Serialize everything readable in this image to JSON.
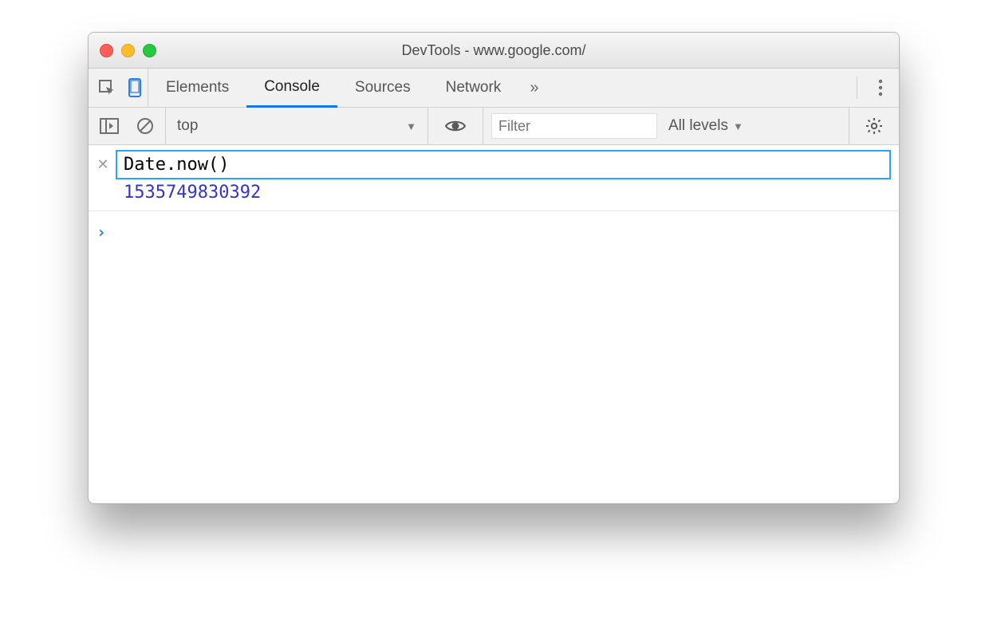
{
  "window": {
    "title": "DevTools - www.google.com/"
  },
  "tabs": {
    "items": [
      "Elements",
      "Console",
      "Sources",
      "Network"
    ],
    "active_index": 1,
    "overflow_glyph": "»"
  },
  "toolbar": {
    "context": "top",
    "context_dropdown_glyph": "▼",
    "filter_placeholder": "Filter",
    "filter_value": "",
    "levels_label": "All levels",
    "levels_dropdown_glyph": "▼"
  },
  "console": {
    "live_expression": "Date.now()",
    "live_result": "1535749830392",
    "prompt_glyph": "›"
  }
}
